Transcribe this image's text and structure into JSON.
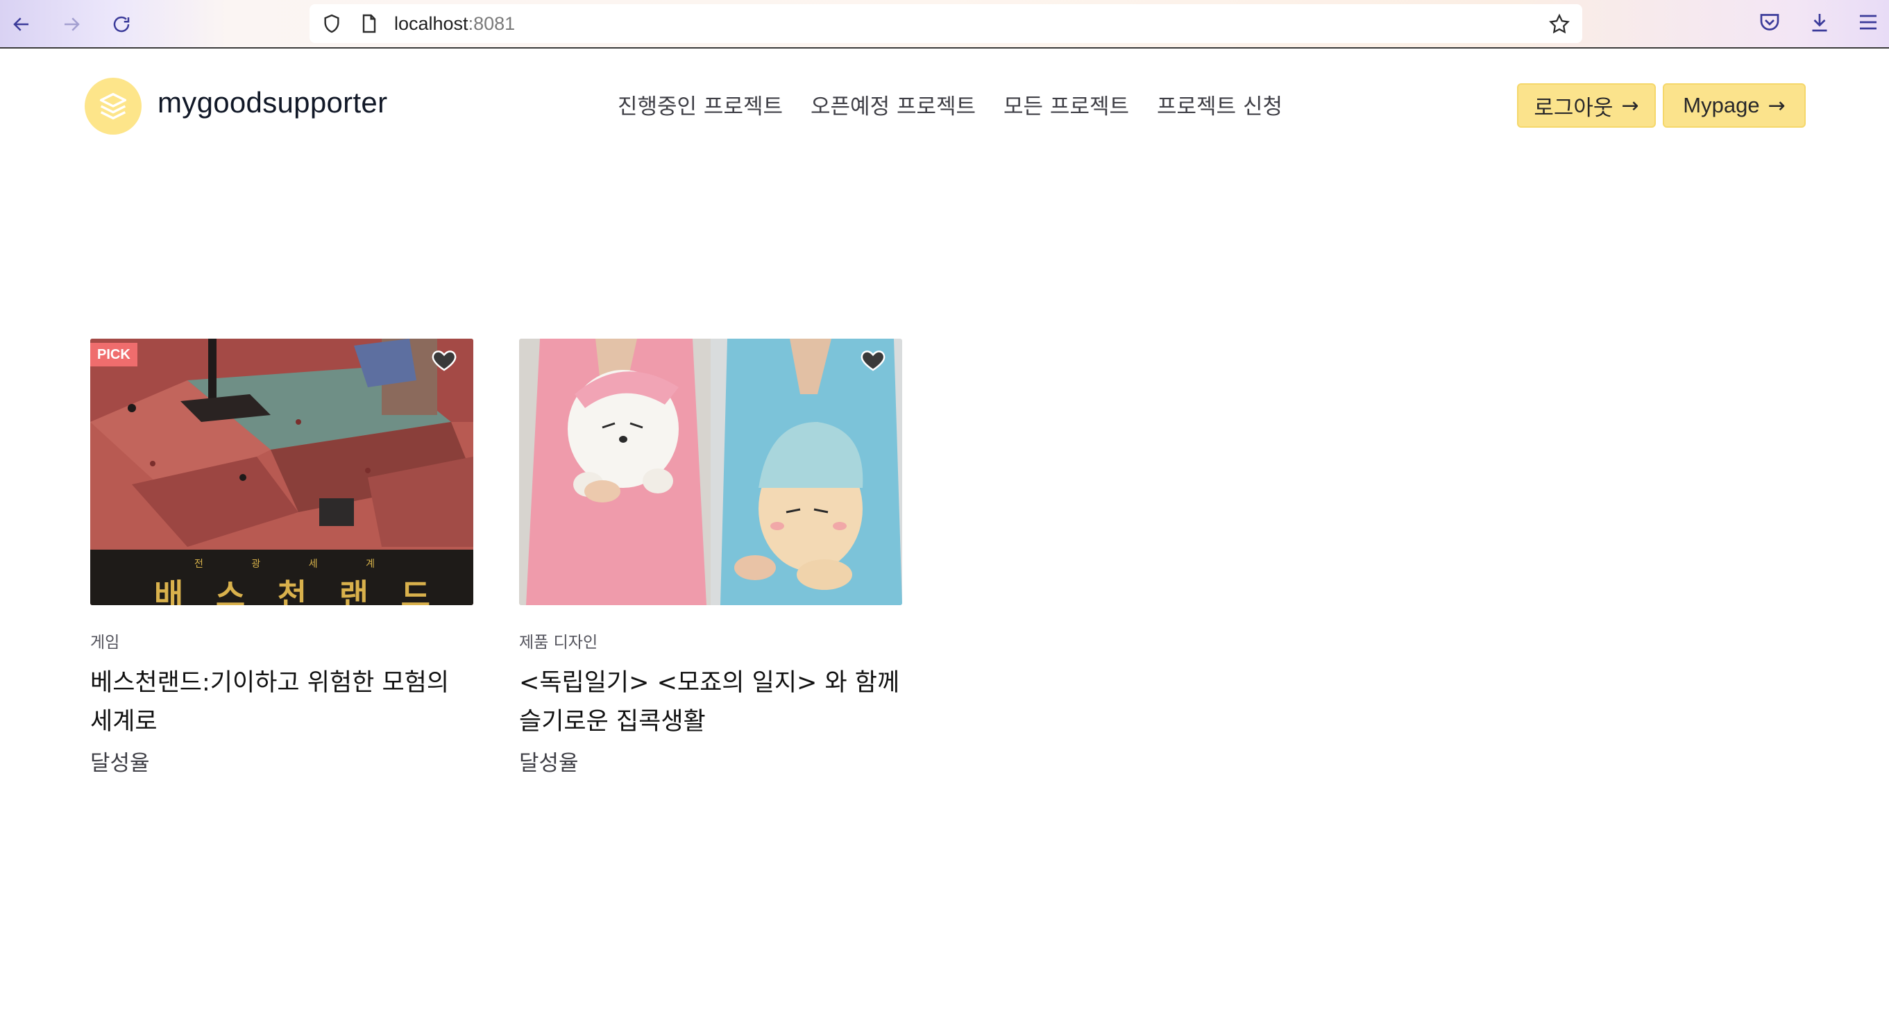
{
  "browser": {
    "url_host": "localhost",
    "url_port": ":8081",
    "icons": [
      "back-arrow-icon",
      "forward-arrow-icon",
      "reload-icon",
      "shield-icon",
      "page-icon",
      "bookmark-star-icon",
      "pocket-icon",
      "download-icon",
      "menu-icon"
    ]
  },
  "header": {
    "brand": "mygoodsupporter",
    "nav": [
      {
        "label": "진행중인 프로젝트"
      },
      {
        "label": "오픈예정 프로젝트"
      },
      {
        "label": "모든 프로젝트"
      },
      {
        "label": "프로젝트 신청"
      }
    ],
    "logout_label": "로그아웃",
    "mypage_label": "Mypage",
    "arrow": "→",
    "accent_color": "#fbe38c"
  },
  "projects": [
    {
      "badge": "PICK",
      "category": "게임",
      "title": "베스천랜드:기이하고 위험한 모험의 세계로",
      "rate_label": "달성율",
      "poster_small": [
        "전",
        "광",
        "세",
        "계"
      ],
      "poster_big": [
        "배",
        "스",
        "천",
        "랜",
        "드"
      ]
    },
    {
      "category": "제품 디자인",
      "title": "<독립일기> <모죠의 일지> 와 함께 슬기로운 집콕생활",
      "rate_label": "달성율"
    }
  ]
}
